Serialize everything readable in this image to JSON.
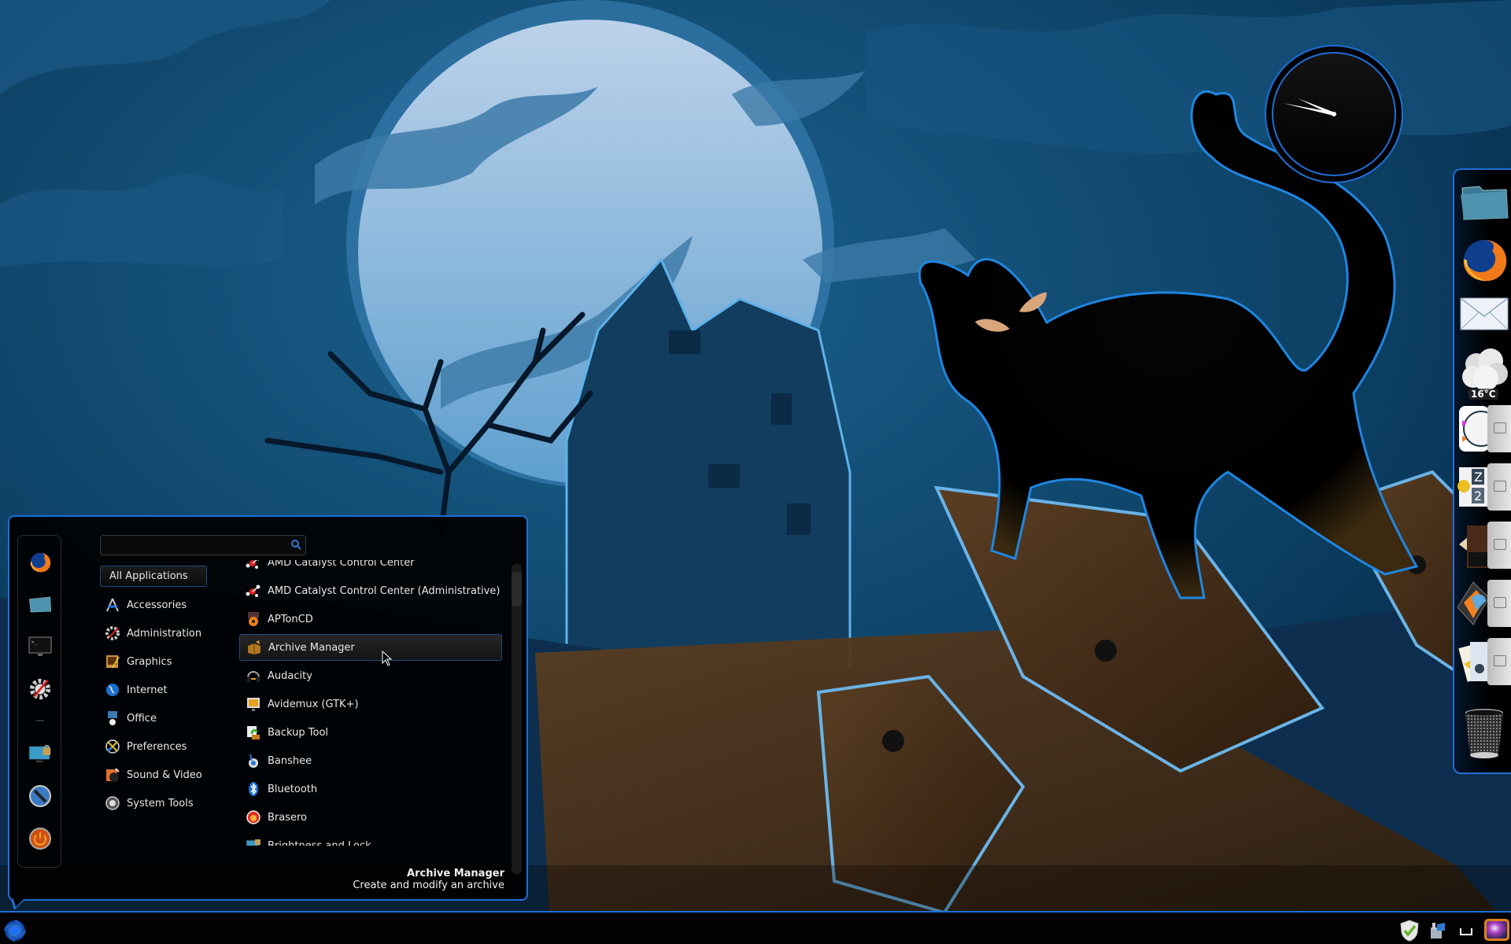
{
  "desktop": {
    "wallpaper": "Halloween night scene: full moon, clouds, haunted house, bare tree and black cat on wooden planks",
    "colors": {
      "accent": "#1f6fd6",
      "sky": "#0b3b5a",
      "moon": "#b3cde6",
      "panel": "#000000"
    }
  },
  "clock": {
    "icon": "analog-clock-desklet",
    "hour": 9,
    "minute": 47
  },
  "menu": {
    "search": {
      "placeholder": "",
      "value": "",
      "icon": "search-icon"
    },
    "favorites": [
      {
        "name": "Firefox",
        "icon": "firefox-icon"
      },
      {
        "name": "Home Folder",
        "icon": "folder-icon"
      },
      {
        "name": "Terminal",
        "icon": "terminal-icon"
      },
      {
        "name": "System Settings",
        "icon": "settings-icon"
      },
      {
        "name": "Lock Screen",
        "icon": "lock-screen-icon"
      },
      {
        "name": "Log Out",
        "icon": "logout-icon"
      },
      {
        "name": "Shut Down",
        "icon": "power-icon"
      }
    ],
    "categories": [
      {
        "label": "All Applications",
        "icon": "",
        "selected": true
      },
      {
        "label": "Accessories",
        "icon": "accessories-icon"
      },
      {
        "label": "Administration",
        "icon": "administration-icon"
      },
      {
        "label": "Graphics",
        "icon": "graphics-icon"
      },
      {
        "label": "Internet",
        "icon": "internet-icon"
      },
      {
        "label": "Office",
        "icon": "office-icon"
      },
      {
        "label": "Preferences",
        "icon": "preferences-icon"
      },
      {
        "label": "Sound & Video",
        "icon": "sound-video-icon"
      },
      {
        "label": "System Tools",
        "icon": "system-tools-icon"
      }
    ],
    "apps": [
      {
        "label": "AMD Catalyst Control Center",
        "icon": "amd-catalyst-icon",
        "partial": true
      },
      {
        "label": "AMD Catalyst Control Center (Administrative)",
        "icon": "amd-catalyst-icon"
      },
      {
        "label": "APTonCD",
        "icon": "aptoncd-icon"
      },
      {
        "label": "Archive Manager",
        "icon": "archive-manager-icon",
        "hovered": true
      },
      {
        "label": "Audacity",
        "icon": "audacity-icon"
      },
      {
        "label": "Avidemux (GTK+)",
        "icon": "avidemux-icon"
      },
      {
        "label": "Backup Tool",
        "icon": "backup-tool-icon"
      },
      {
        "label": "Banshee",
        "icon": "banshee-icon"
      },
      {
        "label": "Bluetooth",
        "icon": "bluetooth-icon"
      },
      {
        "label": "Brasero",
        "icon": "brasero-icon"
      },
      {
        "label": "Brightness and Lock",
        "icon": "brightness-lock-icon"
      }
    ],
    "description": {
      "title": "Archive Manager",
      "text": "Create and modify an archive"
    }
  },
  "taskbar": {
    "start_icon": "start-menu-icon",
    "tray": [
      {
        "name": "update-manager",
        "icon": "shield-check-icon"
      },
      {
        "name": "removable-drive",
        "icon": "drive-icon"
      },
      {
        "name": "show-desktop",
        "icon": "show-desktop-icon"
      },
      {
        "name": "screen-app",
        "icon": "tv-screen-icon"
      }
    ]
  },
  "dock": {
    "items": [
      {
        "name": "Files",
        "icon": "folder-icon"
      },
      {
        "name": "Firefox",
        "icon": "firefox-icon"
      },
      {
        "name": "Mail",
        "icon": "mail-icon"
      },
      {
        "name": "Weather",
        "icon": "weather-icon",
        "temperature": "16°C"
      },
      {
        "name": "Clock stack",
        "icon": "clock-stack-icon"
      },
      {
        "name": "Sleep stack",
        "icon": "sleep-stack-icon"
      },
      {
        "name": "Pictures stack",
        "icon": "pictures-stack-icon"
      },
      {
        "name": "Apps stack",
        "icon": "apps-stack-icon"
      },
      {
        "name": "Documents stack",
        "icon": "documents-stack-icon"
      },
      {
        "name": "Trash",
        "icon": "trash-icon"
      }
    ]
  }
}
